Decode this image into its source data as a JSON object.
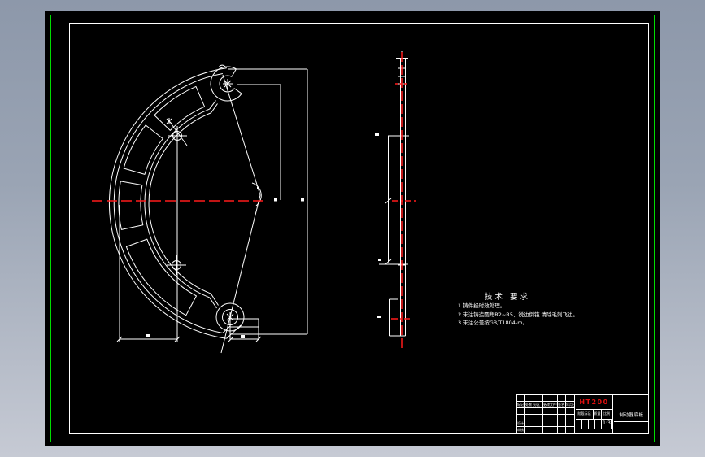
{
  "drawing": {
    "background_color": "#9aa4b4",
    "paper_color": "#000000",
    "frame_color": "#00dd00",
    "line_color": "#ffffff",
    "centerline_color": "#ff1a1a",
    "material_color": "#e01010"
  },
  "tech_requirements": {
    "title": "技术 要求",
    "items": [
      "1.铸件经时效处理。",
      "2.未注铸造圆角R2~R5，锐边倒钝  清除毛刺飞边。",
      "3.未注公差按GB/T1804-m。"
    ]
  },
  "title_block": {
    "material": "HT200",
    "part_name": "制动器底板",
    "revision_headers": [
      "标记",
      "处数",
      "分区",
      "更改文件号",
      "签名",
      "年月日"
    ],
    "role_labels": [
      "设计",
      "审核"
    ],
    "stage_label": "阶段标记",
    "weight_label": "质量",
    "scale_label": "比例",
    "scale_value": "1:3"
  }
}
